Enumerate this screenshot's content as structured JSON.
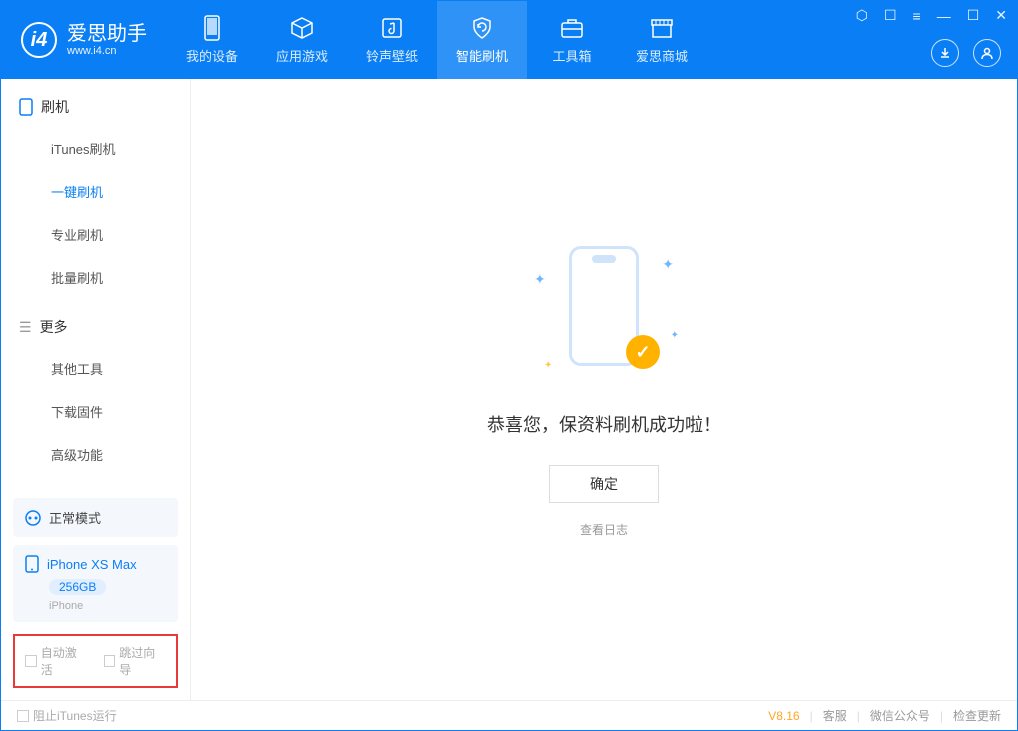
{
  "app": {
    "name_cn": "爱思助手",
    "name_en": "www.i4.cn"
  },
  "top_tabs": [
    {
      "label": "我的设备"
    },
    {
      "label": "应用游戏"
    },
    {
      "label": "铃声壁纸"
    },
    {
      "label": "智能刷机"
    },
    {
      "label": "工具箱"
    },
    {
      "label": "爱思商城"
    }
  ],
  "sidebar": {
    "section1_title": "刷机",
    "items1": [
      {
        "label": "iTunes刷机"
      },
      {
        "label": "一键刷机"
      },
      {
        "label": "专业刷机"
      },
      {
        "label": "批量刷机"
      }
    ],
    "section2_title": "更多",
    "items2": [
      {
        "label": "其他工具"
      },
      {
        "label": "下载固件"
      },
      {
        "label": "高级功能"
      }
    ]
  },
  "mode": {
    "label": "正常模式"
  },
  "device": {
    "name": "iPhone XS Max",
    "capacity": "256GB",
    "type": "iPhone"
  },
  "checkboxes": {
    "auto_activate": "自动激活",
    "skip_guide": "跳过向导"
  },
  "main": {
    "success_text": "恭喜您，保资料刷机成功啦！",
    "confirm_label": "确定",
    "view_log_label": "查看日志"
  },
  "statusbar": {
    "block_itunes": "阻止iTunes运行",
    "version": "V8.16",
    "links": [
      "客服",
      "微信公众号",
      "检查更新"
    ]
  }
}
